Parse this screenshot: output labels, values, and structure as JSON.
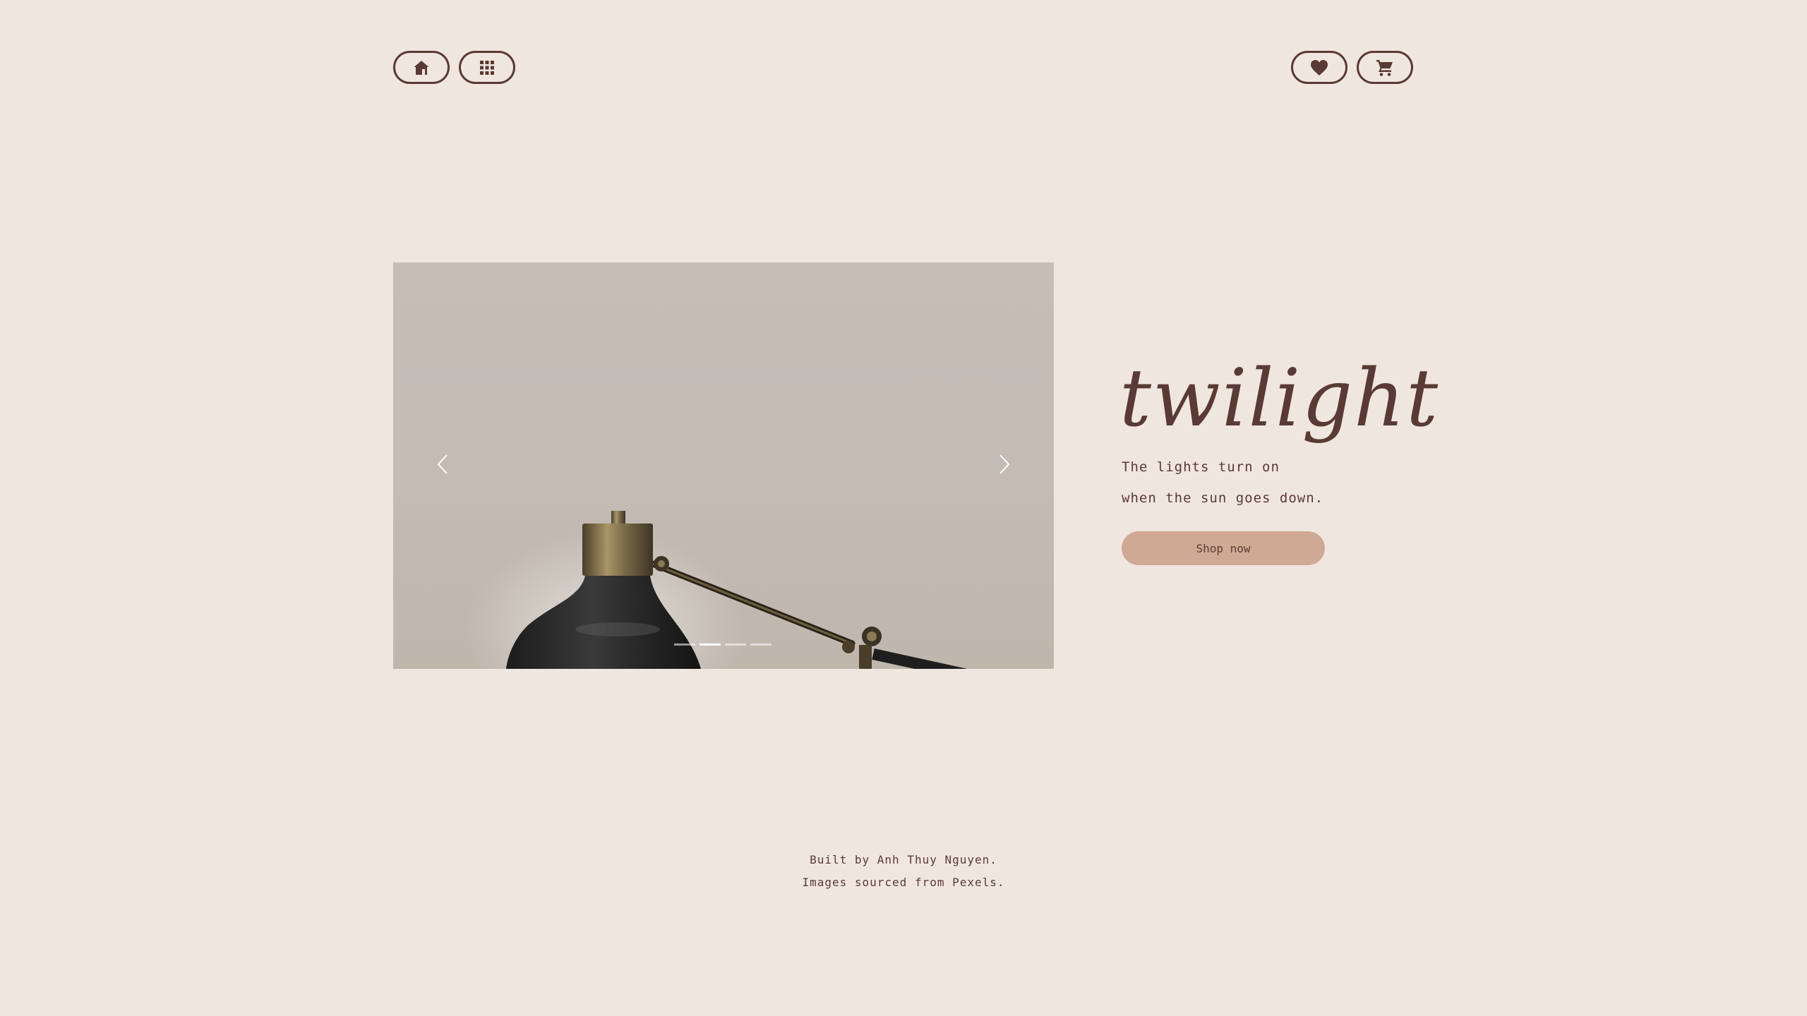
{
  "nav": {
    "left": [
      {
        "icon": "home-icon"
      },
      {
        "icon": "grid-icon"
      }
    ],
    "right": [
      {
        "icon": "heart-icon"
      },
      {
        "icon": "cart-icon"
      }
    ]
  },
  "carousel": {
    "slide_count": 4,
    "active_index": 1,
    "prev_icon": "chevron-left-icon",
    "next_icon": "chevron-right-icon"
  },
  "hero": {
    "title": "twilight",
    "line1": "The lights turn on",
    "line2": "when the sun goes down.",
    "cta_label": "Shop now"
  },
  "footer": {
    "line1": "Built by Anh Thuy Nguyen.",
    "line2": "Images sourced from Pexels."
  },
  "colors": {
    "background": "#f0e6e0",
    "text": "#5a3a34",
    "button": "#d0a995"
  }
}
